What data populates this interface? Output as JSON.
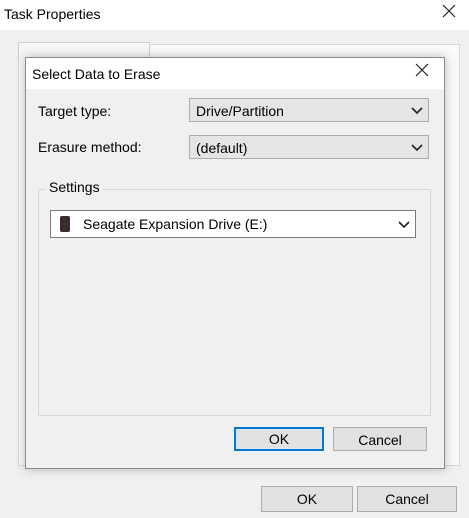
{
  "outer_window": {
    "title": "Task Properties",
    "ok_label": "OK",
    "cancel_label": "Cancel"
  },
  "dialog": {
    "title": "Select Data to Erase",
    "target_type_label": "Target type:",
    "target_type_value": "Drive/Partition",
    "erasure_method_label": "Erasure method:",
    "erasure_method_value": "(default)",
    "settings_legend": "Settings",
    "drive_value": "Seagate Expansion Drive (E:)",
    "ok_label": "OK",
    "cancel_label": "Cancel"
  },
  "icons": {
    "close": "close-icon",
    "chevron": "chevron-down-icon",
    "drive": "drive-icon"
  },
  "colors": {
    "focus_border": "#0078d7",
    "background": "#f0f0f0",
    "titlebar": "#ffffff"
  }
}
